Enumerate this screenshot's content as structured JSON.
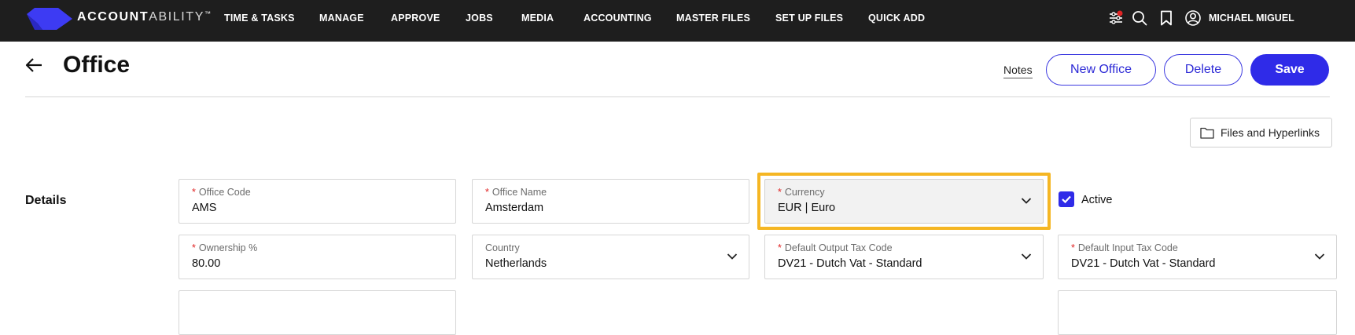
{
  "app": {
    "brand_bold": "ACCOUNT",
    "brand_light": "ABILITY",
    "brand_tm": "™"
  },
  "nav": {
    "items": [
      {
        "label": "TIME & TASKS"
      },
      {
        "label": "MANAGE"
      },
      {
        "label": "APPROVE"
      },
      {
        "label": "JOBS"
      },
      {
        "label": "MEDIA"
      },
      {
        "label": "ACCOUNTING"
      },
      {
        "label": "MASTER FILES"
      },
      {
        "label": "SET UP FILES"
      },
      {
        "label": "QUICK ADD"
      }
    ],
    "icons": [
      "filter-settings-icon",
      "search-icon",
      "bookmark-icon",
      "user-icon"
    ],
    "user_name": "MICHAEL MIGUEL"
  },
  "page": {
    "title": "Office",
    "notes_label": "Notes",
    "new_office_label": "New Office",
    "delete_label": "Delete",
    "save_label": "Save",
    "files_label": "Files and Hyperlinks"
  },
  "details": {
    "section_label": "Details",
    "office_code": {
      "label": "Office Code",
      "value": "AMS",
      "required": true
    },
    "office_name": {
      "label": "Office Name",
      "value": "Amsterdam",
      "required": true
    },
    "currency": {
      "label": "Currency",
      "value": "EUR | Euro",
      "required": true
    },
    "active": {
      "label": "Active",
      "checked": true
    },
    "ownership": {
      "label": "Ownership %",
      "value": "80.00",
      "required": true
    },
    "country": {
      "label": "Country",
      "value": "Netherlands",
      "required": false
    },
    "output_tax": {
      "label": "Default Output Tax Code",
      "value": "DV21 - Dutch Vat - Standard",
      "required": true
    },
    "input_tax": {
      "label": "Default Input Tax Code",
      "value": "DV21 - Dutch Vat - Standard",
      "required": true
    }
  },
  "colors": {
    "topbar": "#1e1e1e",
    "accent": "#2f2be8",
    "logo": "#3d3bf3",
    "focus": "#f5b623",
    "required": "#e02424"
  }
}
